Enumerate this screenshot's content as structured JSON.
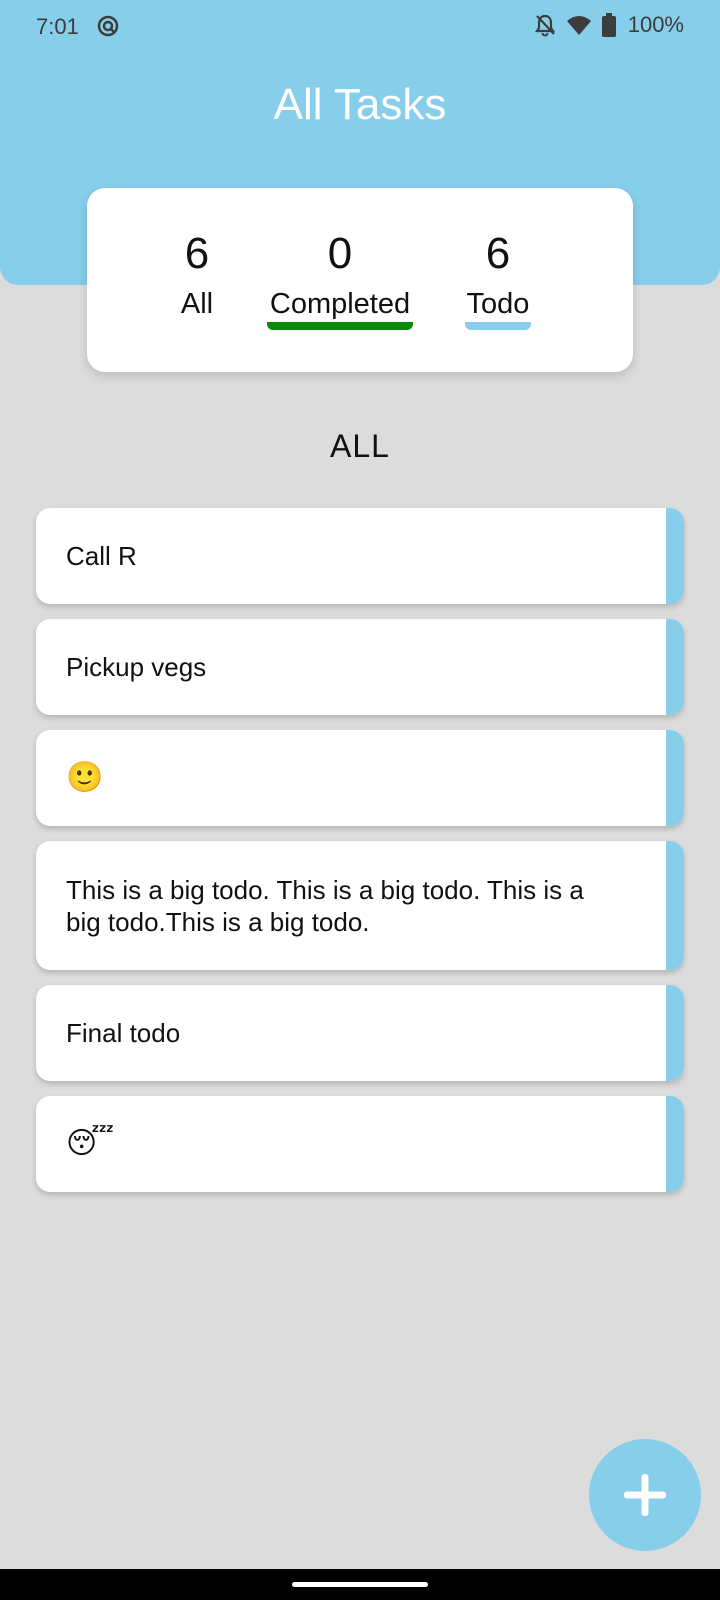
{
  "status_bar": {
    "time": "7:01",
    "battery_pct": "100%",
    "icons": [
      "sync-icon",
      "bell-off-icon",
      "wifi-icon",
      "battery-icon"
    ]
  },
  "header": {
    "title": "All Tasks"
  },
  "stats": {
    "all": {
      "count": "6",
      "label": "All"
    },
    "completed": {
      "count": "0",
      "label": "Completed"
    },
    "todo": {
      "count": "6",
      "label": "Todo"
    }
  },
  "section": {
    "title": "ALL"
  },
  "tasks": [
    {
      "text": "Call R"
    },
    {
      "text": "Pickup vegs"
    },
    {
      "text": "🙂"
    },
    {
      "text": "This is a big todo. This is a big todo. This is a big todo.This is a big todo."
    },
    {
      "text": "Final todo"
    },
    {
      "text": "😴"
    }
  ],
  "fab": {
    "icon": "plus-icon"
  },
  "colors": {
    "accent": "#87ceeb",
    "completed_underline": "#0a8a0a",
    "background": "#dcdcdc"
  }
}
